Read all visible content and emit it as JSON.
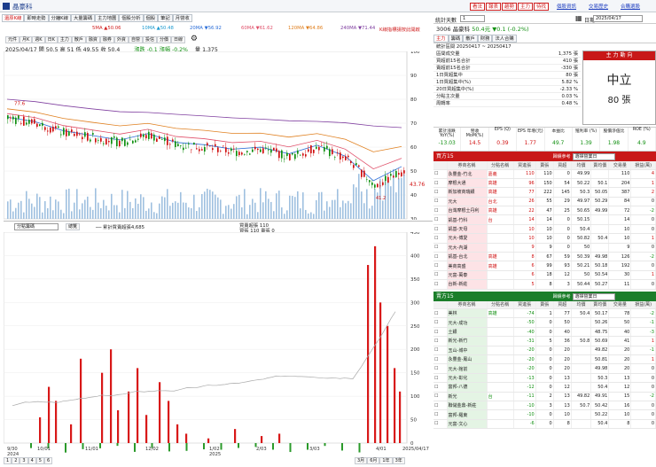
{
  "header": {
    "app_title": "晶豪科",
    "buttons": [
      "看法",
      "報表",
      "趨勢",
      "主力",
      "待找"
    ],
    "links": [
      "個股資訊",
      "交易歷史",
      "合購選股"
    ]
  },
  "left": {
    "tabs": [
      "還原K線",
      "即時走勢",
      "分鐘K線",
      "大量籌碼",
      "主力地圖",
      "個股分析",
      "個股",
      "筆記",
      "月營收"
    ],
    "ma_legend": [
      "5MA ▲50.06",
      "10MA ▲50.48",
      "20MA ▼56.92",
      "60MA ▼61.62",
      "120MA ▼64.86",
      "240MA ▼71.44"
    ],
    "note": "K線指標請按此開啟",
    "chart_tools": [
      "元件",
      "月K",
      "週K",
      "日K",
      "主力",
      "散戶",
      "融資",
      "融券",
      "外資",
      "自營",
      "投信",
      "分價",
      "日線"
    ],
    "quote_line": "2025/04/17  開 50.5  高 51  低 49.55  收 50.4",
    "quote_change": "漲跌 -0.1  漲幅 -0.2%",
    "quote_vol": "量 1,375",
    "price_ticks": [
      "100",
      "90",
      "80",
      "70",
      "60",
      "50",
      "40",
      "30"
    ],
    "price_high": "77.6",
    "price_low_labels": [
      "41.2",
      "43.76"
    ],
    "lower_label": "分點籌碼",
    "lower_btn": "總覽",
    "lower_legend": "── 累計買賣超張4,685",
    "lower_legend2": "買賣超張 110",
    "lower_legend3": "買張 110 賣張 0",
    "vol_ticks": [
      "450",
      "400",
      "350",
      "300",
      "250",
      "200",
      "150",
      "100",
      "50",
      "0"
    ],
    "x_labels": [
      "9/30\n2024",
      "10/01",
      "11/01",
      "12/02",
      "1/02\n2025",
      "2/03",
      "3/03",
      "4/01",
      "2025/04/17"
    ],
    "bottom_pages": [
      "1",
      "2",
      "3",
      "4",
      "5",
      "6"
    ],
    "bottom_periods": [
      "3月",
      "6月",
      "1年",
      "3年"
    ]
  },
  "right": {
    "dropdown_label": "統計天數",
    "dropdown_value": "1",
    "date_label": "日期",
    "date_value": "2025/04/17",
    "stock": "3006 晶豪科",
    "price": "50.4元",
    "change": "▼0.1 (-0.2%)",
    "tabs": [
      "主力",
      "籌碼",
      "散戶",
      "財務",
      "法人合購"
    ],
    "period": "統計區間 20250417 ~ 20250417",
    "stats": [
      [
        "區間成交量",
        "1,375 張"
      ],
      [
        "買超前15名合計",
        "410 張"
      ],
      [
        "賣超前15名合計",
        "-330 張"
      ],
      [
        "1日買超集中",
        "80 張"
      ],
      [
        "1日買超集中(%)",
        "5.82 %"
      ],
      [
        "20日買超集中(%)",
        "-2.33 %"
      ],
      [
        "分點主次量",
        "0.03 %"
      ],
      [
        "周轉率",
        "0.48 %"
      ]
    ],
    "mainforce_title": "主 力 動 向",
    "mainforce_state": "中立",
    "mainforce_value": "80 張",
    "metrics_head": [
      "累計漲跌 YoY(%)",
      "營收 MoM(%)",
      "EPS (Q)",
      "EPS 年增(元)",
      "本益比",
      "殖利率 (%)",
      "股價淨值比",
      "ROE (%)"
    ],
    "metrics_vals": [
      "-13.03",
      "14.5",
      "0.39",
      "1.77",
      "49.7",
      "1.39",
      "1.98",
      "4.9"
    ],
    "buy_title": "買方15",
    "buy_filter": "歸績參考",
    "buy_select": "選擇營業日",
    "cols": [
      "券商名稱",
      "分點名稱",
      "買進張",
      "賣張",
      "買超",
      "均價",
      "賣均價",
      "交易量",
      "損益(萬)"
    ],
    "buy_rows": [
      [
        "永豐金-竹北",
        "嘉義",
        "110",
        "110",
        "0",
        "49.99",
        "",
        "110",
        "4"
      ],
      [
        "摩根大通",
        "高雄",
        "96",
        "150",
        "54",
        "50.22",
        "50.1",
        "204",
        "1"
      ],
      [
        "新加坡商瑞銀",
        "高雄",
        "77",
        "222",
        "145",
        "50.3",
        "50.05",
        "387",
        "2"
      ],
      [
        "元大",
        "台北",
        "26",
        "55",
        "29",
        "49.97",
        "50.29",
        "84",
        "0"
      ],
      [
        "台灣摩根士丹利",
        "高雄",
        "22",
        "47",
        "25",
        "50.65",
        "49.99",
        "72",
        "-2"
      ],
      [
        "凱基-竹科",
        "台",
        "14",
        "14",
        "0",
        "50.15",
        "",
        "14",
        "0"
      ],
      [
        "凱基-天母",
        "",
        "10",
        "10",
        "0",
        "50.4",
        "",
        "10",
        "0"
      ],
      [
        "元大-博愛",
        "",
        "10",
        "10",
        "0",
        "50.82",
        "50.4",
        "10",
        "1"
      ],
      [
        "元大-內湖",
        "",
        "9",
        "9",
        "0",
        "50",
        "",
        "9",
        "0"
      ],
      [
        "凱基-台北",
        "高雄",
        "8",
        "67",
        "59",
        "50.39",
        "49.98",
        "126",
        "-2"
      ],
      [
        "美商高盛",
        "高雄",
        "6",
        "99",
        "93",
        "50.21",
        "50.18",
        "192",
        "0"
      ],
      [
        "元富-萬泰",
        "",
        "6",
        "18",
        "12",
        "50",
        "50.54",
        "30",
        "1"
      ],
      [
        "台新-新莊",
        "",
        "5",
        "8",
        "3",
        "50.44",
        "50.27",
        "11",
        "0"
      ]
    ],
    "sell_title": "賣方15",
    "sell_filter": "歸績參考",
    "sell_select": "選擇營業日",
    "sell_rows": [
      [
        "美林",
        "高雄",
        "-74",
        "1",
        "77",
        "50.4",
        "50.17",
        "78",
        "-2"
      ],
      [
        "元大-成功",
        "",
        "-50",
        "0",
        "50",
        "",
        "50.26",
        "50",
        "-1"
      ],
      [
        "土銀",
        "",
        "-40",
        "0",
        "40",
        "",
        "48.75",
        "40",
        "-3"
      ],
      [
        "新光-新竹",
        "",
        "-31",
        "5",
        "36",
        "50.8",
        "50.69",
        "41",
        "1"
      ],
      [
        "玉山-城中",
        "",
        "-20",
        "0",
        "20",
        "",
        "49.82",
        "20",
        "-1"
      ],
      [
        "永豐金-鳳山",
        "",
        "-20",
        "0",
        "20",
        "",
        "50.81",
        "20",
        "1"
      ],
      [
        "元大-館前",
        "",
        "-20",
        "0",
        "20",
        "",
        "49.98",
        "20",
        "0"
      ],
      [
        "元大-彰化",
        "",
        "-13",
        "0",
        "13",
        "",
        "50.3",
        "13",
        "0"
      ],
      [
        "富邦-八德",
        "",
        "-12",
        "0",
        "12",
        "",
        "50.4",
        "12",
        "0"
      ],
      [
        "新光",
        "台",
        "-11",
        "2",
        "13",
        "49.82",
        "49.91",
        "15",
        "-2"
      ],
      [
        "聯儲金鼎-新莊",
        "",
        "-10",
        "3",
        "13",
        "50.7",
        "50.42",
        "16",
        "0"
      ],
      [
        "富邦-羅東",
        "",
        "-10",
        "0",
        "10",
        "",
        "50.22",
        "10",
        "0"
      ],
      [
        "元富-文心",
        "",
        "-6",
        "0",
        "8",
        "",
        "50.4",
        "8",
        "0"
      ]
    ]
  },
  "chart_data": [
    {
      "type": "candlestick",
      "title": "",
      "xlabel": "",
      "ylabel": "",
      "ylim": [
        30,
        100
      ],
      "series": [
        {
          "name": "收",
          "x": [
            "2024/09/30",
            "2024/10/15",
            "2024/11/01",
            "2024/11/15",
            "2024/12/02",
            "2024/12/16",
            "2025/01/02",
            "2025/01/15",
            "2025/02/03",
            "2025/02/17",
            "2025/03/03",
            "2025/03/17",
            "2025/04/01",
            "2025/04/09",
            "2025/04/17"
          ],
          "values": [
            72,
            70,
            66,
            64,
            62,
            65,
            61,
            60,
            58,
            59,
            56,
            60,
            55,
            43.76,
            50.4
          ]
        }
      ],
      "annotations": [
        "77.6",
        "41.2",
        "43.76"
      ]
    },
    {
      "type": "bar",
      "title": "",
      "xlabel": "",
      "ylabel": "",
      "ylim": [
        0,
        450
      ],
      "series": [
        {
          "name": "買賣超張",
          "values": [
            55,
            120,
            90,
            40,
            180,
            150,
            200,
            70,
            110,
            160,
            60,
            130,
            90,
            40,
            20,
            10,
            30,
            15,
            20,
            380,
            420,
            300,
            250,
            160,
            110
          ]
        }
      ]
    }
  ]
}
